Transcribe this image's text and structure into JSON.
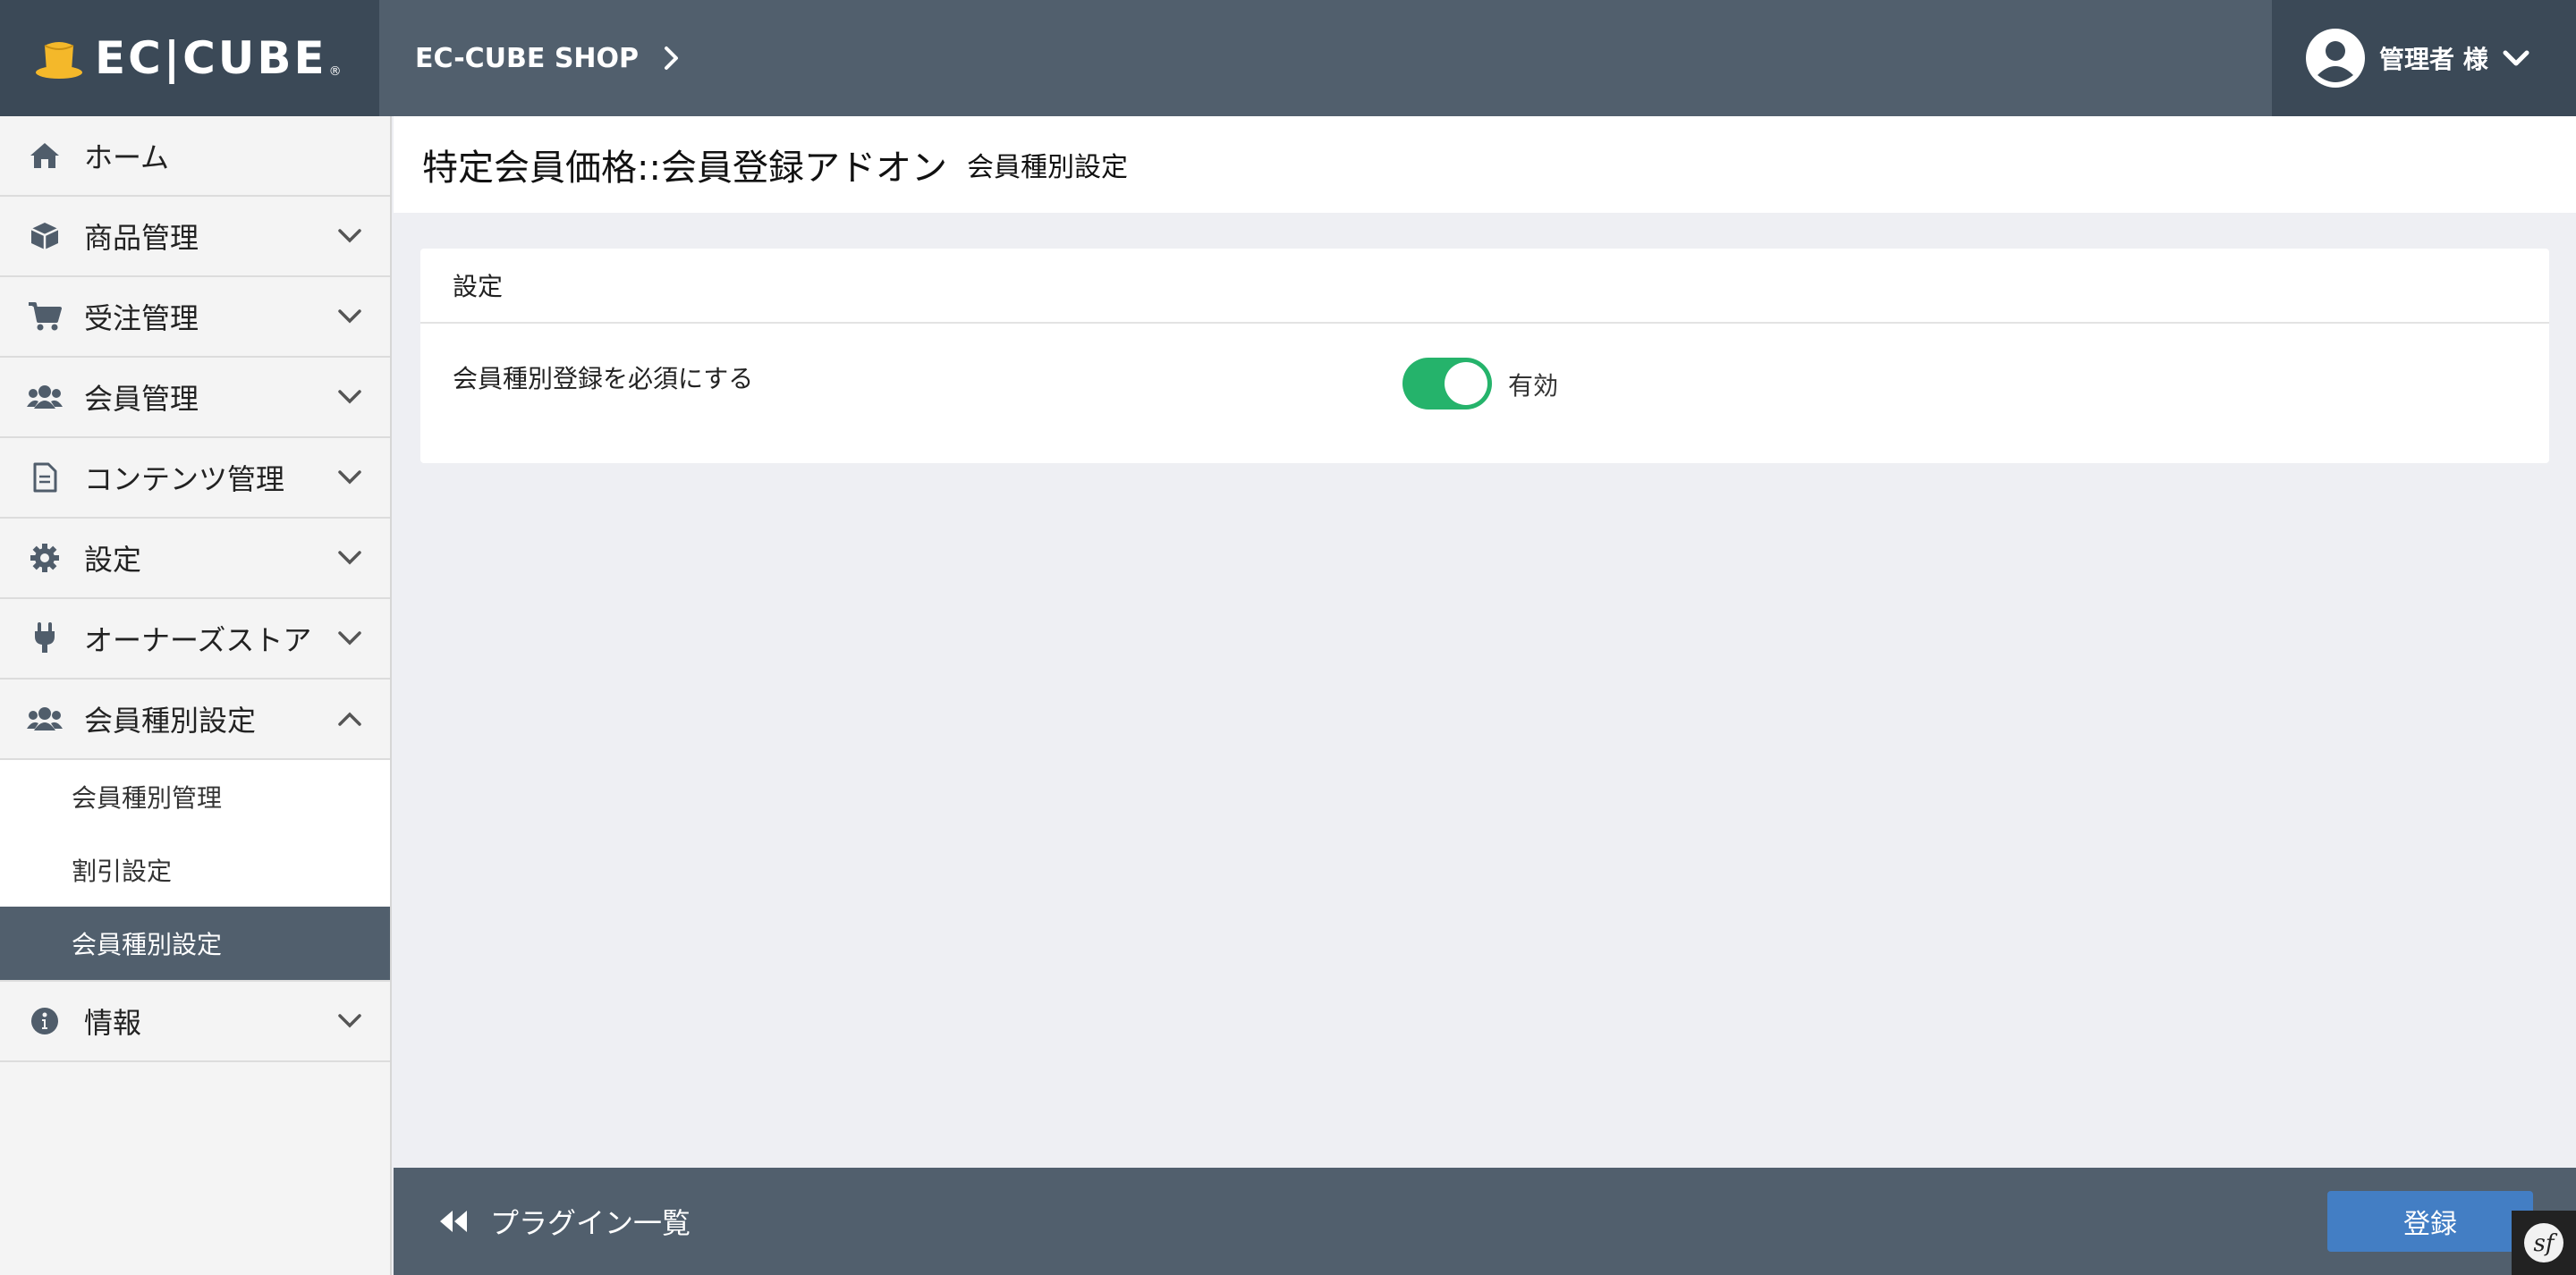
{
  "header": {
    "logo_text": "EC|CUBE",
    "logo_reg": "®",
    "shop_name": "EC-CUBE SHOP",
    "user_name": "管理者 様"
  },
  "sidebar": {
    "items": [
      {
        "label": "ホーム",
        "icon": "home-icon"
      },
      {
        "label": "商品管理",
        "icon": "box-icon"
      },
      {
        "label": "受注管理",
        "icon": "cart-icon"
      },
      {
        "label": "会員管理",
        "icon": "users-icon"
      },
      {
        "label": "コンテンツ管理",
        "icon": "file-icon"
      },
      {
        "label": "設定",
        "icon": "gear-icon"
      },
      {
        "label": "オーナーズストア",
        "icon": "plug-icon"
      },
      {
        "label": "会員種別設定",
        "icon": "users-icon"
      },
      {
        "label": "情報",
        "icon": "info-icon"
      }
    ],
    "sub_items": [
      {
        "label": "会員種別管理"
      },
      {
        "label": "割引設定"
      },
      {
        "label": "会員種別設定",
        "active": true
      }
    ]
  },
  "main": {
    "title": "特定会員価格::会員登録アドオン",
    "subtitle": "会員種別設定",
    "card": {
      "header": "設定",
      "field_label": "会員種別登録を必須にする",
      "toggle_state": "on",
      "toggle_label": "有効"
    }
  },
  "footer": {
    "back_label": "プラグイン一覧",
    "submit_label": "登録"
  },
  "colors": {
    "header_bg": "#515f6d",
    "header_dark": "#3b4957",
    "toggle_on": "#25b36b",
    "primary_button": "#437ec4",
    "logo_accent": "#f4b82a"
  }
}
